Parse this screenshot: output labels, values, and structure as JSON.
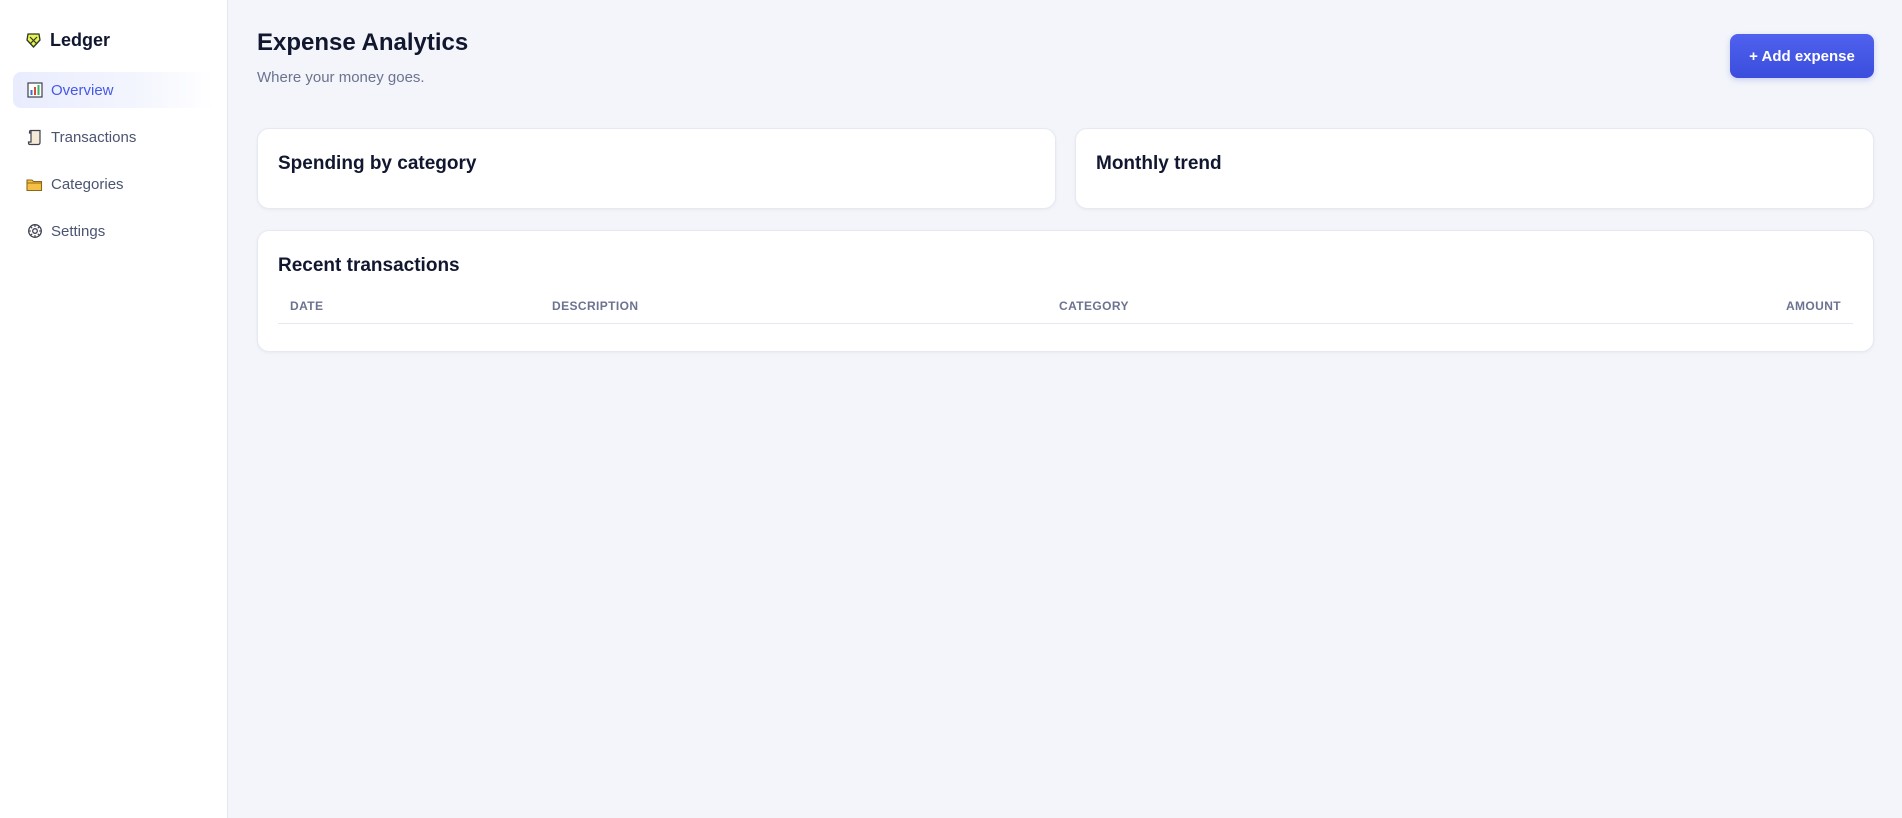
{
  "brand": {
    "title": "Ledger",
    "icon": "ledger-logo-icon"
  },
  "sidebar": {
    "items": [
      {
        "label": "Overview",
        "icon": "chart-icon",
        "active": true
      },
      {
        "label": "Transactions",
        "icon": "scroll-icon",
        "active": false
      },
      {
        "label": "Categories",
        "icon": "folder-icon",
        "active": false
      },
      {
        "label": "Settings",
        "icon": "gear-icon",
        "active": false
      }
    ]
  },
  "header": {
    "title": "Expense Analytics",
    "subtitle": "Where your money goes.",
    "add_button_label": "+ Add expense"
  },
  "cards": {
    "spending_title": "Spending by category",
    "trend_title": "Monthly trend"
  },
  "transactions": {
    "title": "Recent transactions",
    "columns": [
      "DATE",
      "DESCRIPTION",
      "CATEGORY",
      "AMOUNT"
    ],
    "rows": []
  },
  "colors": {
    "accent": "#4659e6",
    "background": "#f3f5fa",
    "text": "#121730",
    "muted": "#6b7390"
  }
}
